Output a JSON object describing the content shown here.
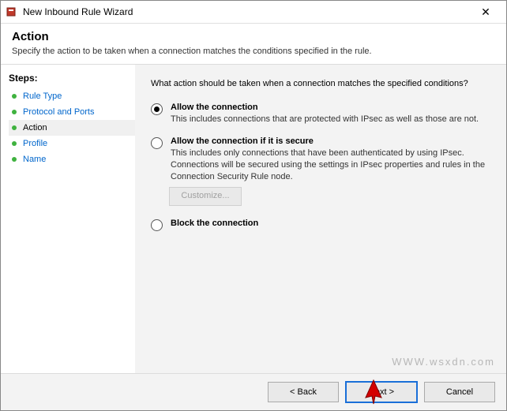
{
  "window": {
    "title": "New Inbound Rule Wizard",
    "close_glyph": "✕"
  },
  "header": {
    "title": "Action",
    "subtitle": "Specify the action to be taken when a connection matches the conditions specified in the rule."
  },
  "sidebar": {
    "steps_label": "Steps:",
    "items": [
      {
        "label": "Rule Type",
        "active": false
      },
      {
        "label": "Protocol and Ports",
        "active": false
      },
      {
        "label": "Action",
        "active": true
      },
      {
        "label": "Profile",
        "active": false
      },
      {
        "label": "Name",
        "active": false
      }
    ]
  },
  "content": {
    "prompt": "What action should be taken when a connection matches the specified conditions?",
    "options": [
      {
        "label": "Allow the connection",
        "desc": "This includes connections that are protected with IPsec as well as those are not.",
        "checked": true
      },
      {
        "label": "Allow the connection if it is secure",
        "desc": "This includes only connections that have been authenticated by using IPsec.  Connections will be secured using the settings in IPsec properties and rules in the Connection Security Rule node.",
        "checked": false
      },
      {
        "label": "Block the connection",
        "desc": "",
        "checked": false
      }
    ],
    "customize_label": "Customize..."
  },
  "footer": {
    "back": "< Back",
    "next": "Next >",
    "cancel": "Cancel"
  },
  "watermark": "WWW.wsxdn.com"
}
